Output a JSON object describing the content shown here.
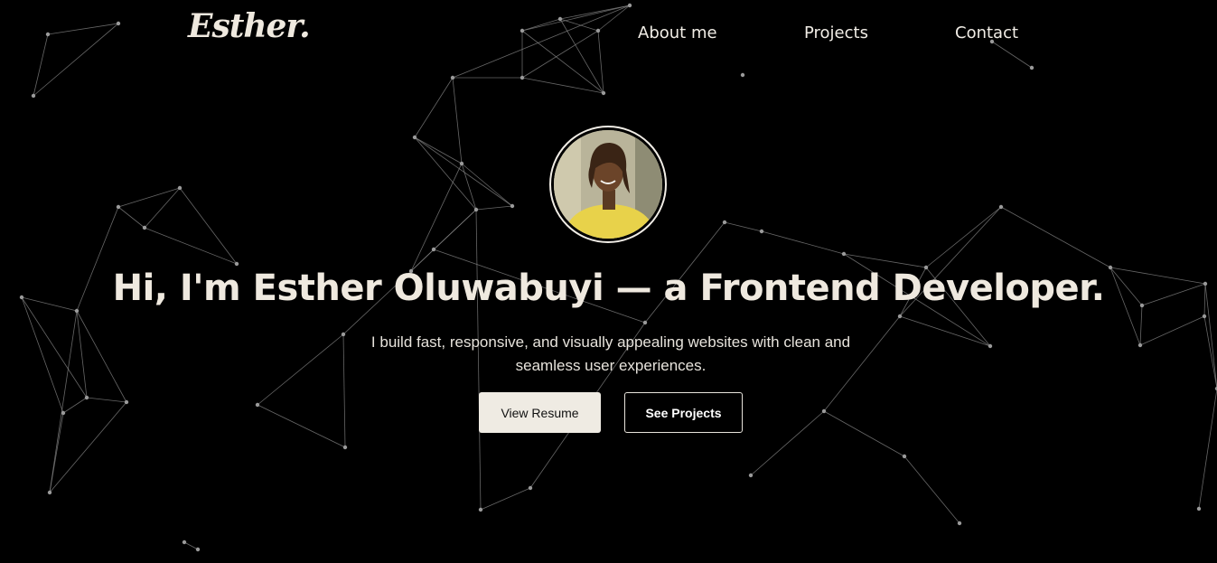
{
  "header": {
    "logo": "Esther.",
    "nav": {
      "about": "About me",
      "projects": "Projects",
      "contact": "Contact"
    }
  },
  "hero": {
    "headline": "Hi, I'm Esther Oluwabuyi — a Frontend Developer.",
    "subtitle": "I build fast, responsive, and visually appealing websites with clean and seamless user experiences.",
    "buttons": {
      "resume": "View Resume",
      "projects": "See Projects"
    }
  },
  "colors": {
    "background": "#000000",
    "text_light": "#efe9df",
    "button_light": "#efebe3"
  }
}
